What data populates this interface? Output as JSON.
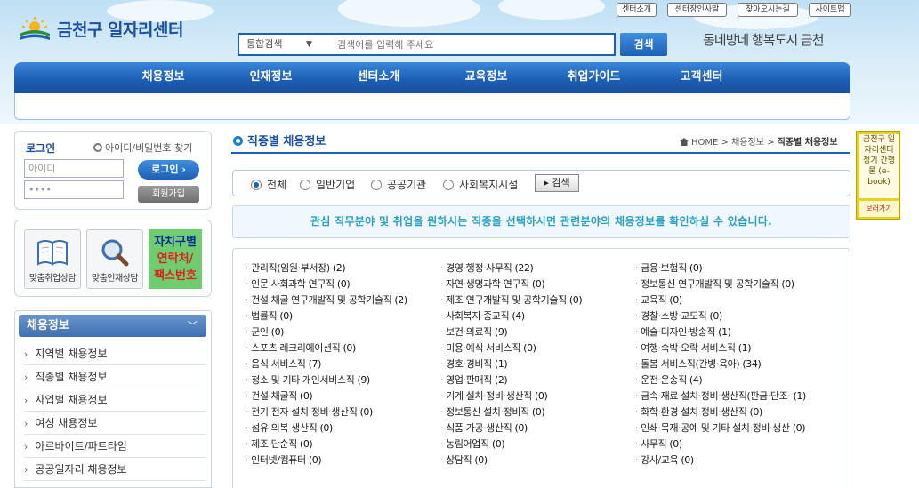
{
  "header": {
    "logo_text": "금천구 일자리센터",
    "util_links": [
      "센터소개",
      "센터장인사말",
      "찾아오시는길",
      "사이트맵"
    ],
    "search_category": "통합검색",
    "search_placeholder": "검색어를 입력해 주세요",
    "search_button": "검색",
    "slogan": "동네방네 행복도시 금천"
  },
  "gnb": [
    "채용정보",
    "인재정보",
    "센터소개",
    "교육정보",
    "취업가이드",
    "고객센터"
  ],
  "login": {
    "title": "로그인",
    "find_link": "아이디/비밀번호 찾기",
    "id_placeholder": "아이디",
    "pw_value": "••••",
    "login_button": "로그인",
    "join_button": "회원가입"
  },
  "quick_links": {
    "item1": "맞춤취업상담",
    "item2": "맞춤인재상담",
    "item3_line1": "자치구별",
    "item3_line2": "연락처/",
    "item3_line3": "팩스번호"
  },
  "side_menu": {
    "title": "채용정보",
    "items": [
      "지역별 채용정보",
      "직종별 채용정보",
      "사업별 채용정보",
      "여성 채용정보",
      "아르바이트/파트타임",
      "공공일자리 채용정보"
    ]
  },
  "main": {
    "title": "직종별 채용정보",
    "breadcrumb": [
      "HOME",
      "채용정보",
      "직종별 채용정보"
    ],
    "radios": [
      "전체",
      "일반기업",
      "공공기관",
      "사회복지시설"
    ],
    "radio_selected": "전체",
    "radio_search": "검색",
    "info": "관심 직무분야 및 취업을 원하시는 직종을 선택하시면 관련분야의 채용정보를 확인하실 수 있습니다."
  },
  "jobs": [
    [
      "관리직(임원·부서장)",
      "(2)"
    ],
    [
      "경영·행정·사무직",
      "(22)"
    ],
    [
      "금융·보험직",
      "(0)"
    ],
    [
      "인문·사회과학 연구직",
      "(0)"
    ],
    [
      "자연·생명과학 연구직",
      "(0)"
    ],
    [
      "정보통신 연구개발직 및 공학기술직",
      "(0)"
    ],
    [
      "건설·채굴 연구개발직 및 공학기술직",
      "(2)"
    ],
    [
      "제조 연구개발직 및 공학기술직",
      "(0)"
    ],
    [
      "교육직",
      "(0)"
    ],
    [
      "법률직",
      "(0)"
    ],
    [
      "사회복지·종교직",
      "(4)"
    ],
    [
      "경찰·소방·교도직",
      "(0)"
    ],
    [
      "군인",
      "(0)"
    ],
    [
      "보건·의료직",
      "(9)"
    ],
    [
      "예술·디자인·방송직",
      "(1)"
    ],
    [
      "스포츠·레크리에이션직",
      "(0)"
    ],
    [
      "미용·예식 서비스직",
      "(0)"
    ],
    [
      "여행·숙박·오락 서비스직",
      "(1)"
    ],
    [
      "음식 서비스직",
      "(7)"
    ],
    [
      "경호·경비직",
      "(1)"
    ],
    [
      "돌봄 서비스직(간병·육아)",
      "(34)"
    ],
    [
      "청소 및 기타 개인서비스직",
      "(9)"
    ],
    [
      "영업·판매직",
      "(2)"
    ],
    [
      "운전·운송직",
      "(4)"
    ],
    [
      "건설·채굴직",
      "(0)"
    ],
    [
      "기계 설치·정비·생산직",
      "(0)"
    ],
    [
      "금속·재료 설치·정비·생산직(판금·단조·",
      "(1)"
    ],
    [
      "전기·전자 설치·정비·생산직",
      "(0)"
    ],
    [
      "정보통신 설치·정비직",
      "(0)"
    ],
    [
      "화학·환경 설치·정비·생산직",
      "(0)"
    ],
    [
      "섬유·의복 생산직",
      "(0)"
    ],
    [
      "식품 가공·생산직",
      "(0)"
    ],
    [
      "인쇄·목재·공예 및 기타 설치·정비·생산",
      "(0)"
    ],
    [
      "제조 단순직",
      "(0)"
    ],
    [
      "농림어업직",
      "(0)"
    ],
    [
      "사무직",
      "(0)"
    ],
    [
      "인터넷/컴퓨터",
      "(0)"
    ],
    [
      "상담직",
      "(0)"
    ],
    [
      "강사/교육",
      "(0)"
    ]
  ],
  "ebook": {
    "text": "금천구 일자리센터 정기 간행물 (e-book)",
    "button": "보러가기"
  },
  "colors": {
    "brand_blue": "#1e5fb8",
    "info_text": "#2a9fc4",
    "quick_green": "#70cc70",
    "ebook_yellow": "#e6d02a"
  }
}
